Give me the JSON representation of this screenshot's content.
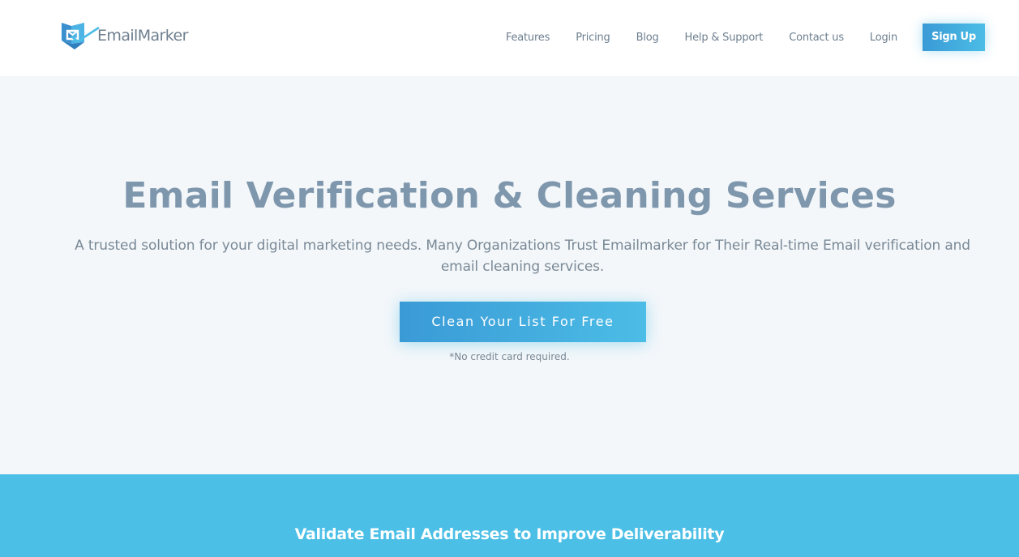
{
  "brand": {
    "name": "EmailMarker",
    "logo_icon": "envelope-shield-checkmark-icon",
    "colors": {
      "primary": "#4cbde6",
      "primary_dark": "#3a9ad6",
      "heading": "#7f97ad",
      "text": "#7a8996",
      "hero_bg": "#f3f7fa",
      "band_bg": "#4cbfe6"
    }
  },
  "nav": {
    "items": [
      {
        "label": "Features"
      },
      {
        "label": "Pricing"
      },
      {
        "label": "Blog"
      },
      {
        "label": "Help & Support"
      },
      {
        "label": "Contact us"
      },
      {
        "label": "Login"
      }
    ],
    "signup_label": "Sign Up"
  },
  "hero": {
    "title": "Email Verification & Cleaning Services",
    "subtitle": "A trusted solution for your digital marketing needs. Many Organizations Trust Emailmarker for Their Real-time Email verification and email cleaning services.",
    "cta_label": "Clean Your List For Free",
    "note": "*No credit card required."
  },
  "section": {
    "title": "Validate Email Addresses to Improve Deliverability"
  }
}
